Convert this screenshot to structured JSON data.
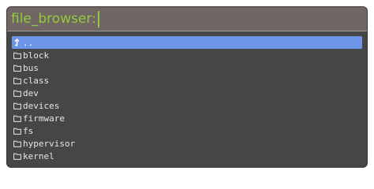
{
  "prompt": {
    "label": "file_browser:",
    "input_value": ""
  },
  "entries": [
    {
      "name": "..",
      "icon": "parent-directory-icon",
      "selected": true
    },
    {
      "name": "block",
      "icon": "folder-icon",
      "selected": false
    },
    {
      "name": "bus",
      "icon": "folder-icon",
      "selected": false
    },
    {
      "name": "class",
      "icon": "folder-icon",
      "selected": false
    },
    {
      "name": "dev",
      "icon": "folder-icon",
      "selected": false
    },
    {
      "name": "devices",
      "icon": "folder-icon",
      "selected": false
    },
    {
      "name": "firmware",
      "icon": "folder-icon",
      "selected": false
    },
    {
      "name": "fs",
      "icon": "folder-icon",
      "selected": false
    },
    {
      "name": "hypervisor",
      "icon": "folder-icon",
      "selected": false
    },
    {
      "name": "kernel",
      "icon": "folder-icon",
      "selected": false
    }
  ],
  "colors": {
    "prompt_bar_bg": "#726665",
    "prompt_text": "#8fcc3a",
    "list_bg": "#464646",
    "selection_bg": "#6c95e8",
    "entry_text": "#e6e6e6"
  }
}
